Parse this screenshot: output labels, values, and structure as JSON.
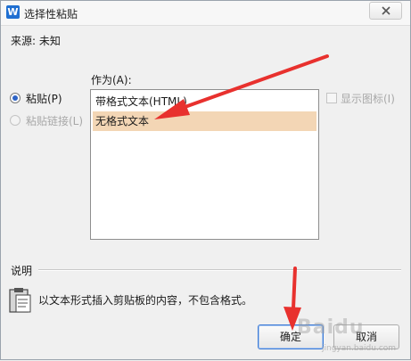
{
  "window": {
    "title": "选择性粘贴",
    "app_icon": "W"
  },
  "source": {
    "label": "来源: 未知"
  },
  "paste_as": {
    "label": "作为(A):",
    "options": [
      {
        "label": "粘贴(P)",
        "checked": true,
        "enabled": true
      },
      {
        "label": "粘贴链接(L)",
        "checked": false,
        "enabled": false
      }
    ],
    "list_items": [
      {
        "label": "带格式文本(HTML)",
        "selected": false
      },
      {
        "label": "无格式文本",
        "selected": true
      }
    ],
    "show_icon_label": "显示图标(I)"
  },
  "description": {
    "title": "说明",
    "text": "以文本形式插入剪贴板的内容，不包含格式。"
  },
  "buttons": {
    "ok": "确定",
    "cancel": "取消"
  },
  "colors": {
    "selection": "#f3d6b5",
    "annotation_arrow": "#e8312e",
    "radio_dot": "#2d63c5"
  },
  "watermark": {
    "text": "Baidu",
    "sub": "jingyan.baidu.com"
  }
}
